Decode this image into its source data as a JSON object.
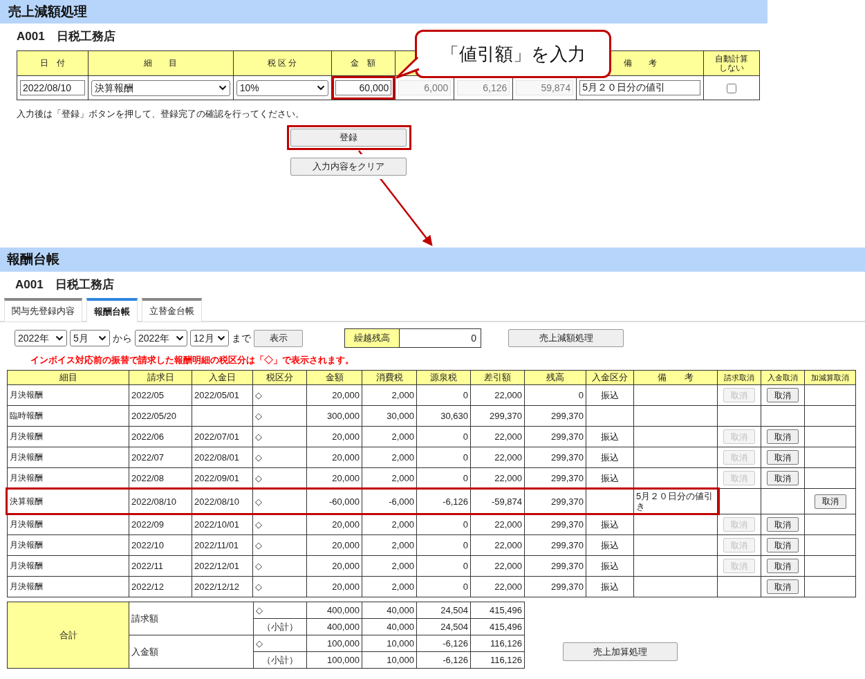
{
  "reduction": {
    "title": "売上減額処理",
    "client": "A001　日税工務店",
    "callout": "「値引額」を入力",
    "fields": [
      {
        "kind": "text",
        "header": "日　付",
        "value": "2022/08/10"
      },
      {
        "kind": "select",
        "header": "細　　目",
        "value": "決算報酬"
      },
      {
        "kind": "select",
        "header": "税 区 分",
        "value": "10%"
      },
      {
        "kind": "amount",
        "header": "金　額",
        "value": "60,000",
        "highlighted": true
      },
      {
        "kind": "readonly",
        "value": "6,000",
        "disabled": true
      },
      {
        "kind": "readonly",
        "value": "6,126",
        "disabled": true
      },
      {
        "kind": "readonly",
        "value": "59,874",
        "disabled": true
      },
      {
        "kind": "text",
        "header": "備　　考",
        "value": "5月２０日分の値引"
      },
      {
        "kind": "checkbox",
        "header": "自動計算しない",
        "checked": false
      }
    ],
    "note": "入力後は「登録」ボタンを押して、登録完了の確認を行ってください。",
    "buttons": [
      {
        "label": "登録",
        "highlighted": true
      },
      {
        "label": "入力内容をクリア",
        "highlighted": false
      }
    ]
  },
  "ledger": {
    "title": "報酬台帳",
    "client": "A001　日税工務店",
    "tabs": [
      {
        "label": "関与先登録内容",
        "selected": false
      },
      {
        "label": "報酬台帳",
        "selected": true
      },
      {
        "label": "立替金台帳",
        "selected": false
      }
    ],
    "filter": {
      "from_year": "2022年",
      "from_month": "5月",
      "from_text": "から",
      "to_year": "2022年",
      "to_month": "12月",
      "to_text": "まで",
      "show_button": "表示"
    },
    "balance": {
      "label": "繰越残高",
      "value": "0"
    },
    "reduction_button": "売上減額処理",
    "notice": "インボイス対応前の振替で請求した報酬明細の税区分は「◇」で表示されます。",
    "columns": [
      "細目",
      "請求日",
      "入金日",
      "税区分",
      "金額",
      "消費税",
      "源泉税",
      "差引額",
      "残高",
      "入金区分",
      "備　　考",
      "請求取消",
      "入金取消",
      "加減算取消"
    ],
    "rows": [
      {
        "highlighted": false,
        "item": "月決報酬",
        "billed": "2022/05",
        "paid": "2022/05/01",
        "tax": "◇",
        "amount": "20,000",
        "consumption_tax": "2,000",
        "withholding": "0",
        "net": "22,000",
        "balance": "0",
        "payment_type": "振込",
        "billing_cancel": {
          "label": "取消",
          "disabled": true
        },
        "payment_cancel": {
          "label": "取消",
          "disabled": false
        }
      },
      {
        "highlighted": false,
        "item": "臨時報酬",
        "billed": "2022/05/20",
        "tax": "◇",
        "amount": "300,000",
        "consumption_tax": "30,000",
        "withholding": "30,630",
        "net": "299,370",
        "balance": "299,370"
      },
      {
        "highlighted": false,
        "item": "月決報酬",
        "billed": "2022/06",
        "paid": "2022/07/01",
        "tax": "◇",
        "amount": "20,000",
        "consumption_tax": "2,000",
        "withholding": "0",
        "net": "22,000",
        "balance": "299,370",
        "payment_type": "振込",
        "billing_cancel": {
          "label": "取消",
          "disabled": true
        },
        "payment_cancel": {
          "label": "取消",
          "disabled": false
        }
      },
      {
        "highlighted": false,
        "item": "月決報酬",
        "billed": "2022/07",
        "paid": "2022/08/01",
        "tax": "◇",
        "amount": "20,000",
        "consumption_tax": "2,000",
        "withholding": "0",
        "net": "22,000",
        "balance": "299,370",
        "payment_type": "振込",
        "billing_cancel": {
          "label": "取消",
          "disabled": true
        },
        "payment_cancel": {
          "label": "取消",
          "disabled": false
        }
      },
      {
        "highlighted": false,
        "item": "月決報酬",
        "billed": "2022/08",
        "paid": "2022/09/01",
        "tax": "◇",
        "amount": "20,000",
        "consumption_tax": "2,000",
        "withholding": "0",
        "net": "22,000",
        "balance": "299,370",
        "payment_type": "振込",
        "billing_cancel": {
          "label": "取消",
          "disabled": true
        },
        "payment_cancel": {
          "label": "取消",
          "disabled": false
        }
      },
      {
        "highlighted": true,
        "item": "決算報酬",
        "billed": "2022/08/10",
        "paid": "2022/08/10",
        "tax": "◇",
        "amount": "-60,000",
        "consumption_tax": "-6,000",
        "withholding": "-6,126",
        "net": "-59,874",
        "balance": "299,370",
        "remarks": "5月２０日分の値引き",
        "adjust_cancel": {
          "label": "取消",
          "disabled": false
        }
      },
      {
        "highlighted": false,
        "item": "月決報酬",
        "billed": "2022/09",
        "paid": "2022/10/01",
        "tax": "◇",
        "amount": "20,000",
        "consumption_tax": "2,000",
        "withholding": "0",
        "net": "22,000",
        "balance": "299,370",
        "payment_type": "振込",
        "billing_cancel": {
          "label": "取消",
          "disabled": true
        },
        "payment_cancel": {
          "label": "取消",
          "disabled": false
        }
      },
      {
        "highlighted": false,
        "item": "月決報酬",
        "billed": "2022/10",
        "paid": "2022/11/01",
        "tax": "◇",
        "amount": "20,000",
        "consumption_tax": "2,000",
        "withholding": "0",
        "net": "22,000",
        "balance": "299,370",
        "payment_type": "振込",
        "billing_cancel": {
          "label": "取消",
          "disabled": true
        },
        "payment_cancel": {
          "label": "取消",
          "disabled": false
        }
      },
      {
        "highlighted": false,
        "item": "月決報酬",
        "billed": "2022/11",
        "paid": "2022/12/01",
        "tax": "◇",
        "amount": "20,000",
        "consumption_tax": "2,000",
        "withholding": "0",
        "net": "22,000",
        "balance": "299,370",
        "payment_type": "振込",
        "billing_cancel": {
          "label": "取消",
          "disabled": true
        },
        "payment_cancel": {
          "label": "取消",
          "disabled": false
        }
      },
      {
        "highlighted": false,
        "item": "月決報酬",
        "billed": "2022/12",
        "paid": "2022/12/12",
        "tax": "◇",
        "amount": "20,000",
        "consumption_tax": "2,000",
        "withholding": "0",
        "net": "22,000",
        "balance": "299,370",
        "payment_type": "振込",
        "payment_cancel": {
          "label": "取消",
          "disabled": false
        }
      }
    ],
    "totals": {
      "label": "合計",
      "groups": [
        {
          "label": "請求額",
          "lines": [
            [
              "◇",
              "400,000",
              "40,000",
              "24,504",
              "415,496"
            ],
            [
              "（小計）",
              "400,000",
              "40,000",
              "24,504",
              "415,496"
            ]
          ]
        },
        {
          "label": "入金額",
          "lines": [
            [
              "◇",
              "100,000",
              "10,000",
              "-6,126",
              "116,126"
            ],
            [
              "（小計）",
              "100,000",
              "10,000",
              "-6,126",
              "116,126"
            ]
          ]
        }
      ]
    },
    "addition_button": "売上加算処理"
  }
}
